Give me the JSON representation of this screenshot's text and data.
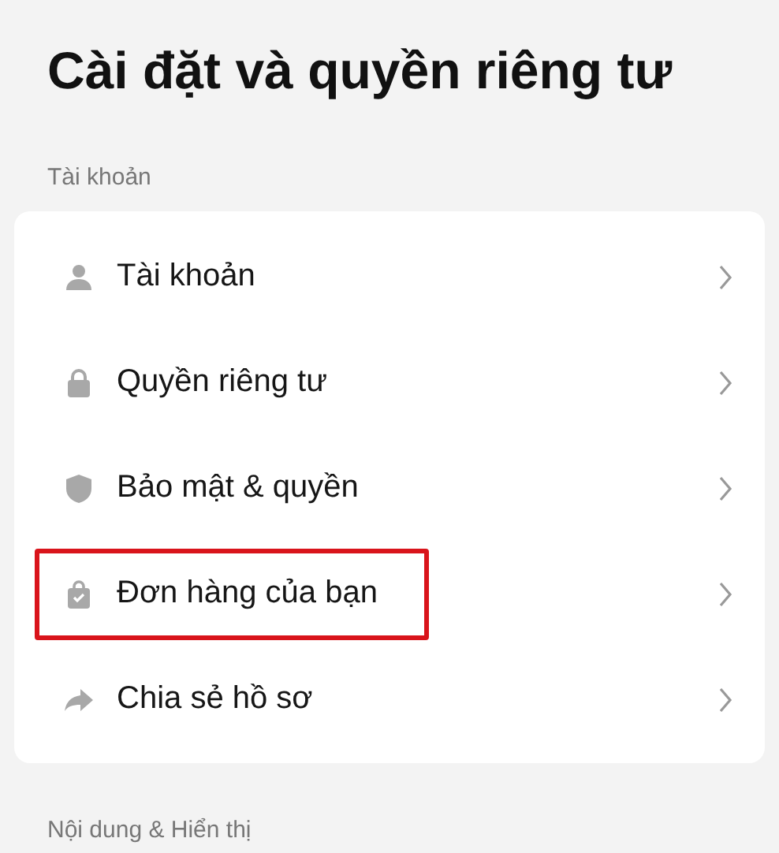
{
  "title": "Cài đặt và quyền riêng tư",
  "sections": [
    {
      "label": "Tài khoản",
      "items": [
        {
          "kind": "person",
          "label": "Tài khoản",
          "highlighted": false
        },
        {
          "kind": "lock",
          "label": "Quyền riêng tư",
          "highlighted": false
        },
        {
          "kind": "shield",
          "label": "Bảo mật & quyền",
          "highlighted": false
        },
        {
          "kind": "bag",
          "label": "Đơn hàng của bạn",
          "highlighted": true
        },
        {
          "kind": "share",
          "label": "Chia sẻ hồ sơ",
          "highlighted": false
        }
      ]
    },
    {
      "label": "Nội dung & Hiển thị"
    }
  ]
}
